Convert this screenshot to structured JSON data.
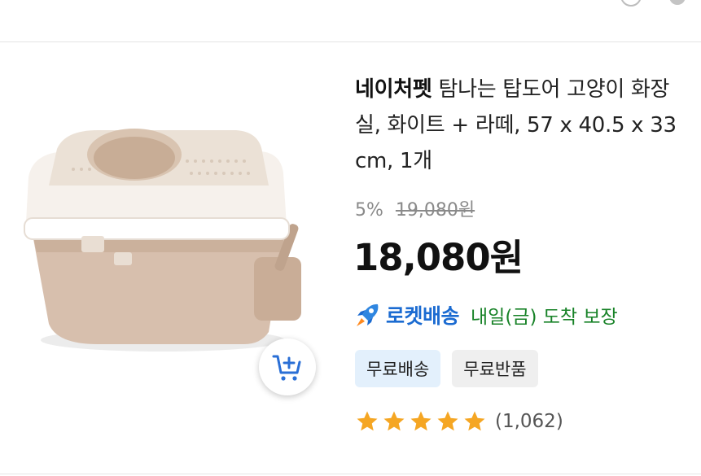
{
  "topbar": {
    "icons": [
      "user-icon",
      "dot-icon"
    ]
  },
  "product": {
    "image_icon": "cat-litter-box",
    "brand": "네이처펫",
    "title": "탐나는 탑도어 고양이 화장실, 화이트 + 라떼, 57 x 40.5 x 33 cm, 1개",
    "discount_rate": "5%",
    "original_price": "19,080원",
    "price": "18,080원",
    "rocket_label": "로켓배송",
    "delivery_text": "내일(금) 도착 보장",
    "badges": [
      "무료배송",
      "무료반품"
    ],
    "rating_stars": 5,
    "review_count": "(1,062)"
  },
  "colors": {
    "rocket_blue": "#1b6bd1",
    "delivery_green": "#178227",
    "star": "#f5a623",
    "badge_blue_bg": "#e3f0fc",
    "badge_gray_bg": "#efefef"
  }
}
